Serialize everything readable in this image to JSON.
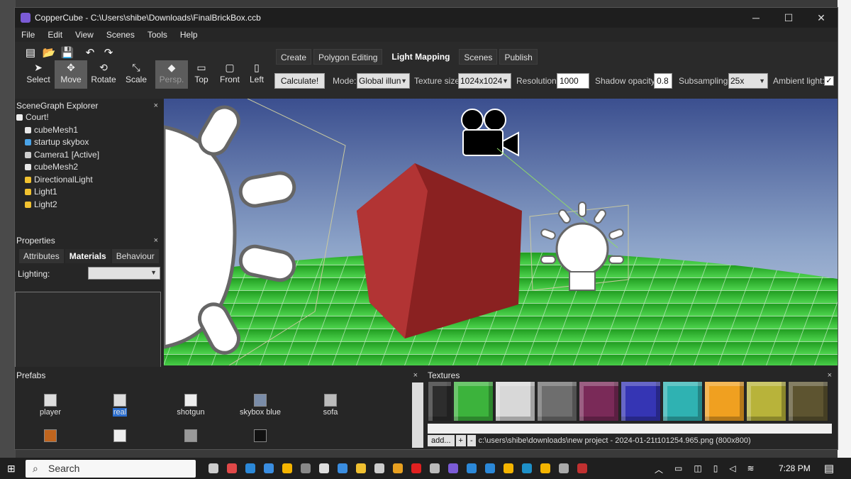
{
  "window": {
    "title": "CopperCube - C:\\Users\\shibe\\Downloads\\FinalBrickBox.ccb",
    "minimize": "─",
    "maximize": "☐",
    "close": "✕"
  },
  "menu": [
    "File",
    "Edit",
    "View",
    "Scenes",
    "Tools",
    "Help"
  ],
  "quick": {
    "new": "▤",
    "open": "📂",
    "save": "💾",
    "undo": "↶",
    "redo": "↷"
  },
  "tools": [
    {
      "label": "Select",
      "icon": "cursor-icon"
    },
    {
      "label": "Move",
      "icon": "move-icon"
    },
    {
      "label": "Rotate",
      "icon": "rotate-icon"
    },
    {
      "label": "Scale",
      "icon": "scale-icon"
    },
    {
      "label": "Persp.",
      "icon": "cube-icon"
    },
    {
      "label": "Top",
      "icon": "view-top-icon"
    },
    {
      "label": "Front",
      "icon": "view-front-icon"
    },
    {
      "label": "Left",
      "icon": "view-left-icon"
    }
  ],
  "tabs": [
    "Create",
    "Polygon Editing",
    "Light Mapping",
    "Scenes",
    "Publish"
  ],
  "lightmap": {
    "calculate": "Calculate!",
    "mode_label": "Mode:",
    "mode_value": "Global illun",
    "texsize_label": "Texture size:",
    "texsize_value": "1024x1024",
    "resolution_label": "Resolution:",
    "resolution_value": "1000",
    "shadow_label": "Shadow opacity:",
    "shadow_value": "0.8",
    "subsampling_label": "Subsampling:",
    "subsampling_value": "25x",
    "ambient_label": "Ambient light:",
    "ambient_check": "✓"
  },
  "scenegraph": {
    "title": "SceneGraph Explorer",
    "close": "×",
    "root": "Court!",
    "items": [
      "cubeMesh1",
      "startup skybox",
      "Camera1 [Active]",
      "cubeMesh2",
      "DirectionalLight",
      "Light1",
      "Light2"
    ],
    "colors": [
      "#e8e8e8",
      "#4aa3e8",
      "#cfcfcf",
      "#e8e8e8",
      "#f2c230",
      "#f2c230",
      "#f2c230"
    ]
  },
  "properties": {
    "title": "Properties",
    "close": "×",
    "tabs": [
      "Attributes",
      "Materials",
      "Behaviour"
    ],
    "lighting_label": "Lighting:"
  },
  "prefabs": {
    "title": "Prefabs",
    "close": "×",
    "items": [
      "player",
      "real",
      "shotgun",
      "skybox blue",
      "sofa"
    ],
    "row2": [
      "",
      "",
      "",
      ""
    ]
  },
  "textures": {
    "title": "Textures",
    "close": "×",
    "colors": [
      "#2d2d2d",
      "#3cb33c",
      "#d8d8d8",
      "#6e6e6e",
      "#7a2a58",
      "#3535b4",
      "#2fb2b2",
      "#f0a020",
      "#b8b33a",
      "#5d5430"
    ],
    "add": "add...",
    "plus": "+",
    "minus": "-",
    "path": "c:\\users\\shibe\\downloads\\new project - 2024-01-21t101254.965.png (800x800)"
  },
  "taskbar": {
    "search": "Search",
    "time": "7:28 PM"
  }
}
